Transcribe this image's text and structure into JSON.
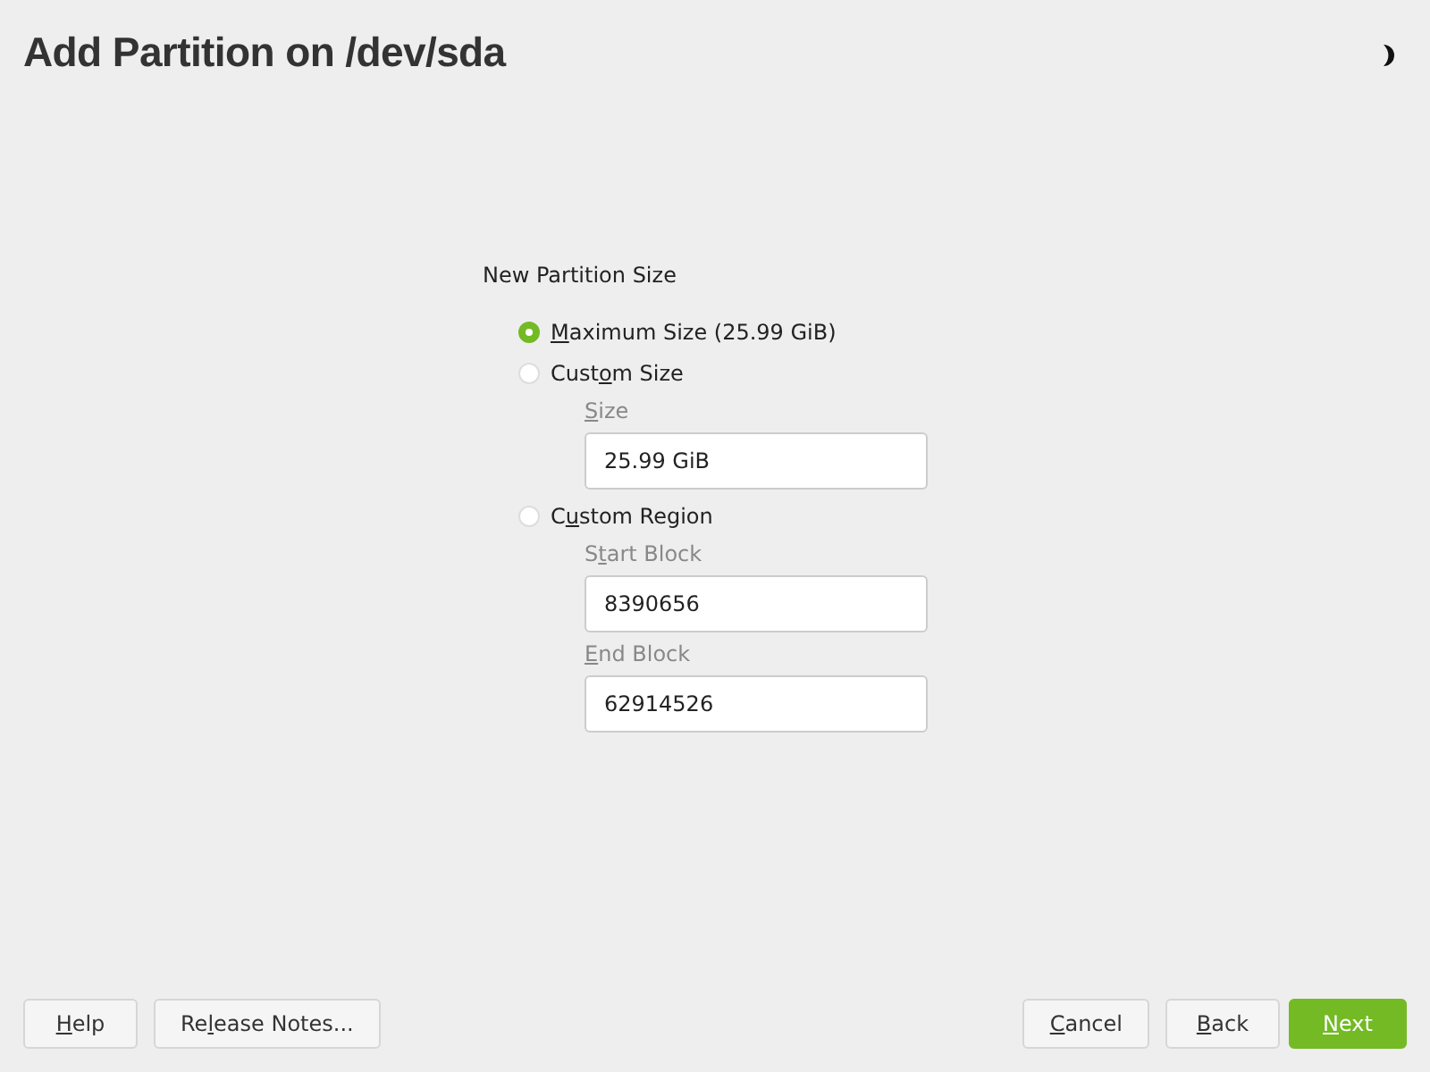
{
  "window": {
    "title": "Add Partition on /dev/sda"
  },
  "group": {
    "title": "New Partition Size"
  },
  "options": [
    {
      "label": {
        "key": "M",
        "post": "aximum Size (25.99 GiB)"
      },
      "selected": true
    },
    {
      "label": {
        "pre": "Cust",
        "key": "o",
        "post": "m Size"
      },
      "selected": false,
      "fields": [
        {
          "label": {
            "key": "S",
            "post": "ize"
          },
          "value": "25.99 GiB"
        }
      ]
    },
    {
      "label": {
        "pre": "C",
        "key": "u",
        "post": "stom Region"
      },
      "selected": false,
      "fields": [
        {
          "label": {
            "pre": "S",
            "key": "t",
            "post": "art Block"
          },
          "value": "8390656"
        },
        {
          "label": {
            "key": "E",
            "post": "nd Block"
          },
          "value": "62914526"
        }
      ]
    }
  ],
  "buttons_left": [
    {
      "label": {
        "key": "H",
        "post": "elp"
      },
      "kind": "normal"
    },
    {
      "label": {
        "pre": "Re",
        "key": "l",
        "post": "ease Notes..."
      },
      "kind": "normal"
    }
  ],
  "buttons_right": [
    {
      "label": {
        "key": "C",
        "post": "ancel"
      },
      "kind": "normal"
    },
    {
      "label": {
        "key": "B",
        "post": "ack"
      },
      "kind": "normal"
    },
    {
      "label": {
        "key": "N",
        "post": "ext"
      },
      "kind": "primary"
    }
  ]
}
